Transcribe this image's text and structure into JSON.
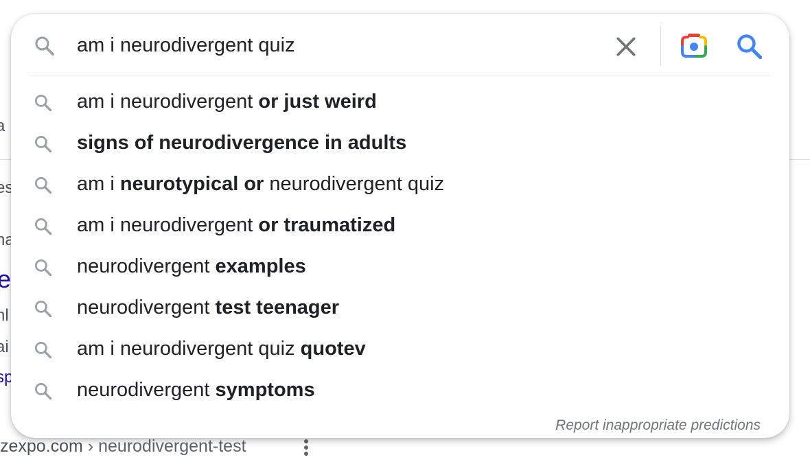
{
  "search": {
    "query": "am i neurodivergent quiz",
    "icons": {
      "leading": "search-icon",
      "clear": "close-icon",
      "lens": "google-lens-camera-icon",
      "submit": "search-icon"
    },
    "colors": {
      "submit_icon": "#4285f4",
      "lens_blue": "#4285f4",
      "lens_red": "#ea4335",
      "lens_yellow": "#fbbc04",
      "lens_green": "#34a853"
    }
  },
  "suggestions": [
    {
      "parts": [
        {
          "text": "am i neurodivergent ",
          "bold": false
        },
        {
          "text": "or just weird",
          "bold": true
        }
      ]
    },
    {
      "parts": [
        {
          "text": "signs of neurodivergence in adults",
          "bold": true
        }
      ]
    },
    {
      "parts": [
        {
          "text": "am i ",
          "bold": false
        },
        {
          "text": "neurotypical or",
          "bold": true
        },
        {
          "text": " neurodivergent quiz",
          "bold": false
        }
      ]
    },
    {
      "parts": [
        {
          "text": "am i neurodivergent ",
          "bold": false
        },
        {
          "text": "or traumatized",
          "bold": true
        }
      ]
    },
    {
      "parts": [
        {
          "text": "neurodivergent ",
          "bold": false
        },
        {
          "text": "examples",
          "bold": true
        }
      ]
    },
    {
      "parts": [
        {
          "text": "neurodivergent ",
          "bold": false
        },
        {
          "text": "test teenager",
          "bold": true
        }
      ]
    },
    {
      "parts": [
        {
          "text": "am i neurodivergent quiz ",
          "bold": false
        },
        {
          "text": "quotev",
          "bold": true
        }
      ]
    },
    {
      "parts": [
        {
          "text": "neurodivergent ",
          "bold": false
        },
        {
          "text": "symptoms",
          "bold": true
        }
      ]
    }
  ],
  "report_link": "Report inappropriate predictions",
  "background_page": {
    "fragments": [
      {
        "text": "a",
        "style": "normal"
      },
      {
        "text": "es",
        "style": "normal"
      },
      {
        "text": "ha",
        "style": "normal"
      },
      {
        "text": "e",
        "style": "big"
      },
      {
        "text": "nl",
        "style": "normal"
      },
      {
        "text": "ai",
        "style": "normal"
      },
      {
        "text": "sp",
        "style": "link"
      }
    ],
    "url_domain": "zexpo.com",
    "url_separator": " › ",
    "url_path": "neurodivergent-test",
    "more_icon": "more-vertical-icon"
  }
}
